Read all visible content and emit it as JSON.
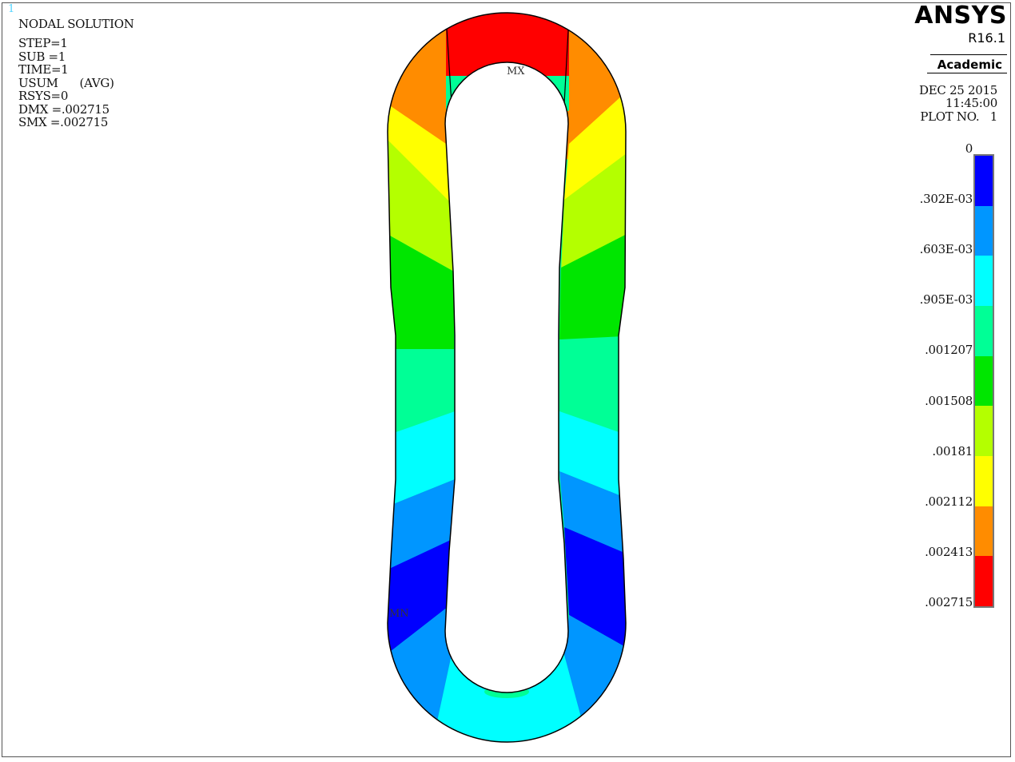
{
  "window_number": "1",
  "solution_info": [
    "NODAL SOLUTION",
    "STEP=1",
    "SUB =1",
    "TIME=1",
    "USUM      (AVG)",
    "RSYS=0",
    "DMX =.002715",
    "SMX =.002715"
  ],
  "brand": {
    "name": "ANSYS",
    "release": "R16.1",
    "edition": "Academic"
  },
  "plot_info": {
    "date": "DEC 25 2015",
    "time": "11:45:00",
    "plot_no": "PLOT NO.   1"
  },
  "markers": {
    "max": "MX",
    "min": "MN"
  },
  "legend": {
    "labels": [
      "0",
      ".302E-03",
      ".603E-03",
      ".905E-03",
      ".001207",
      ".001508",
      ".00181",
      ".002112",
      ".002413",
      ".002715"
    ],
    "colors": [
      "#0000ff",
      "#0096ff",
      "#00ffff",
      "#00ff96",
      "#00e600",
      "#b4ff00",
      "#ffff00",
      "#ff8c00",
      "#ff0000"
    ]
  }
}
